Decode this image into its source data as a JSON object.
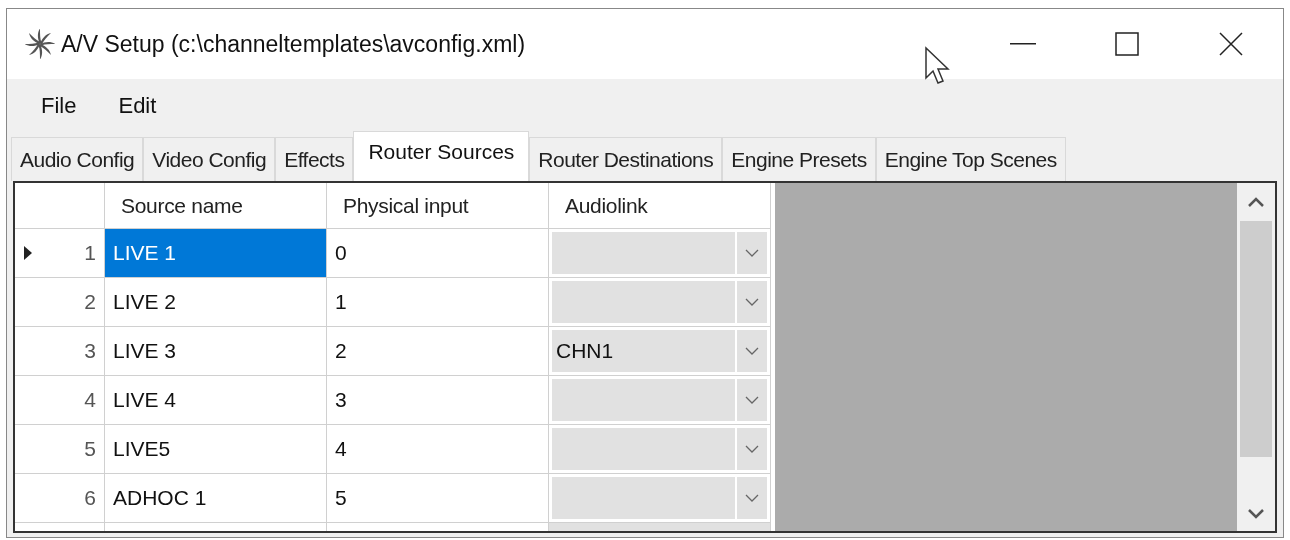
{
  "window": {
    "title": "A/V Setup (c:\\channeltemplates\\avconfig.xml)"
  },
  "menu": [
    {
      "label": "File"
    },
    {
      "label": "Edit"
    }
  ],
  "tabs": [
    {
      "label": "Audio Config",
      "selected": false
    },
    {
      "label": "Video Config",
      "selected": false
    },
    {
      "label": "Effects",
      "selected": false
    },
    {
      "label": "Router Sources",
      "selected": true
    },
    {
      "label": "Router Destinations",
      "selected": false
    },
    {
      "label": "Engine Presets",
      "selected": false
    },
    {
      "label": "Engine Top Scenes",
      "selected": false
    }
  ],
  "table": {
    "columns": [
      "Source name",
      "Physical input",
      "Audiolink"
    ],
    "rows": [
      {
        "number": "1",
        "current": true,
        "selected": true,
        "name": "LIVE 1",
        "input": "0",
        "audiolink": ""
      },
      {
        "number": "2",
        "current": false,
        "selected": false,
        "name": "LIVE 2",
        "input": "1",
        "audiolink": ""
      },
      {
        "number": "3",
        "current": false,
        "selected": false,
        "name": "LIVE 3",
        "input": "2",
        "audiolink": "CHN1"
      },
      {
        "number": "4",
        "current": false,
        "selected": false,
        "name": "LIVE 4",
        "input": "3",
        "audiolink": ""
      },
      {
        "number": "5",
        "current": false,
        "selected": false,
        "name": "LIVE5",
        "input": "4",
        "audiolink": ""
      },
      {
        "number": "6",
        "current": false,
        "selected": false,
        "name": "ADHOC 1",
        "input": "5",
        "audiolink": ""
      }
    ]
  }
}
